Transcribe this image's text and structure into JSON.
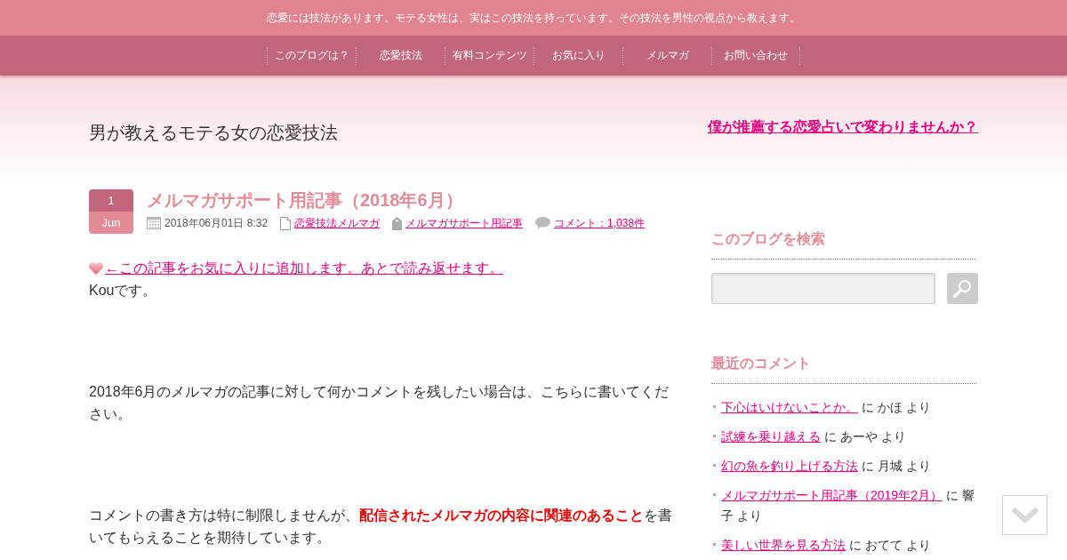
{
  "header": {
    "tagline": "恋愛には技法があります。モテる女性は、実はこの技法を持っています。その技法を男性の視点から教えます。"
  },
  "nav": {
    "items": [
      {
        "label": "このブログは？"
      },
      {
        "label": "恋愛技法"
      },
      {
        "label": "有料コンテンツ"
      },
      {
        "label": "お気に入り"
      },
      {
        "label": "メルマガ"
      },
      {
        "label": "お問い合わせ"
      }
    ]
  },
  "site_title": "男が教えるモテる女の恋愛技法",
  "promo_link": "僕が推薦する恋愛占いで変わりませんか？",
  "post": {
    "date": {
      "day": "1",
      "month": "Jun"
    },
    "title": "メルマガサポート用記事（2018年6月）",
    "meta": [
      {
        "kind": "date",
        "text": "2018年06月01日 8:32"
      },
      {
        "kind": "category",
        "text": "恋愛技法メルマガ"
      },
      {
        "kind": "tag",
        "text": "メルマガサポート用記事"
      },
      {
        "kind": "comments",
        "text": "コメント：1,038件"
      }
    ],
    "favorite_link": "←この記事をお気に入りに追加します。あとで読み返せます。",
    "paragraphs": [
      "Kouです。",
      "2018年6月のメルマガの記事に対して何かコメントを残したい場合は、こちらに書いてください。",
      "コメントの書き方は特に制限しませんが、**配信されたメルマガの内容に関連のあること**を書いてもらえることを期待しています。"
    ]
  },
  "sidebar": {
    "search": {
      "title": "このブログを検索"
    },
    "recent_comments": {
      "title": "最近のコメント",
      "items": [
        {
          "post": "下心はいけないことか。",
          "byline": "に かほ より"
        },
        {
          "post": "試練を乗り越える",
          "byline": "に あーや より"
        },
        {
          "post": "幻の魚を釣り上げる方法",
          "byline": "に 月城 より"
        },
        {
          "post": "メルマガサポート用記事（2019年2月）",
          "byline": "に 響子 より"
        },
        {
          "post": "美しい世界を見る方法",
          "byline": "に おてて より"
        }
      ]
    }
  }
}
